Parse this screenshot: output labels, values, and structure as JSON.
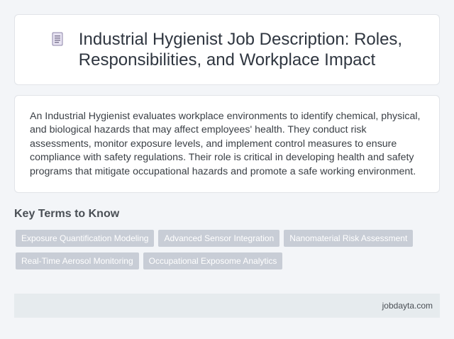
{
  "header": {
    "icon": "document-icon",
    "title": "Industrial Hygienist Job Description: Roles, Responsibilities, and Workplace Impact"
  },
  "description": "An Industrial Hygienist evaluates workplace environments to identify chemical, physical, and biological hazards that may affect employees' health. They conduct risk assessments, monitor exposure levels, and implement control measures to ensure compliance with safety regulations. Their role is critical in developing health and safety programs that mitigate occupational hazards and promote a safe working environment.",
  "key_terms": {
    "heading": "Key Terms to Know",
    "tags": [
      "Exposure Quantification Modeling",
      "Advanced Sensor Integration",
      "Nanomaterial Risk Assessment",
      "Real-Time Aerosol Monitoring",
      "Occupational Exposome Analytics"
    ]
  },
  "footer": {
    "site": "jobdayta.com"
  },
  "colors": {
    "background": "#f3f5f8",
    "card": "#ffffff",
    "tag_bg": "#c8cdd6",
    "footer_bg": "#e6ebee"
  }
}
